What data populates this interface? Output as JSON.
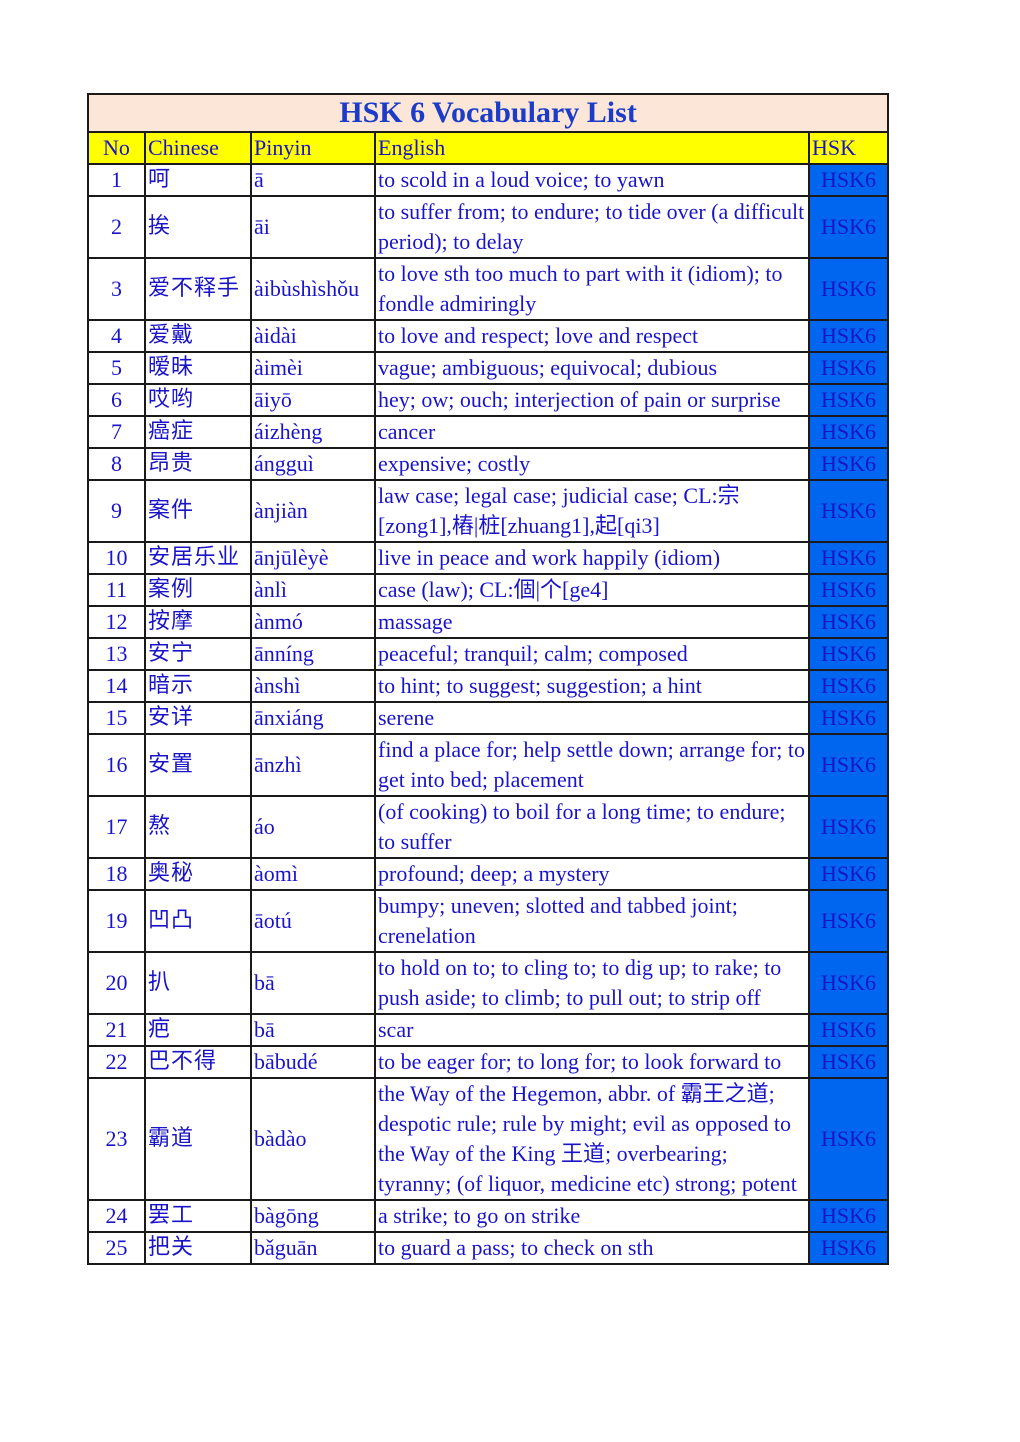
{
  "title": "HSK 6 Vocabulary List",
  "columns": {
    "no": "No",
    "chinese": "Chinese",
    "pinyin": "Pinyin",
    "english": "English",
    "hsk": "HSK"
  },
  "colors": {
    "title_bg": "#fce6d8",
    "header_bg": "#ffff00",
    "hsk_bg": "#0066f0",
    "text": "#1a14c8"
  },
  "rows": [
    {
      "no": "1",
      "chinese": "呵",
      "pinyin": "ā",
      "english": "to scold in a loud voice; to yawn",
      "hsk": "HSK6"
    },
    {
      "no": "2",
      "chinese": "挨",
      "pinyin": "āi",
      "english": "to suffer from; to endure; to tide over (a difficult period); to delay",
      "hsk": "HSK6"
    },
    {
      "no": "3",
      "chinese": "爱不释手",
      "pinyin": "àibùshìshǒu",
      "english": "to love sth too much to part with it (idiom); to fondle admiringly",
      "hsk": "HSK6"
    },
    {
      "no": "4",
      "chinese": "爱戴",
      "pinyin": "àidài",
      "english": "to love and respect; love and respect",
      "hsk": "HSK6"
    },
    {
      "no": "5",
      "chinese": "暧昧",
      "pinyin": "àimèi",
      "english": "vague; ambiguous; equivocal; dubious",
      "hsk": "HSK6"
    },
    {
      "no": "6",
      "chinese": "哎哟",
      "pinyin": "āiyō",
      "english": "hey; ow; ouch; interjection of pain or surprise",
      "hsk": "HSK6"
    },
    {
      "no": "7",
      "chinese": "癌症",
      "pinyin": "áizhèng",
      "english": "cancer",
      "hsk": "HSK6"
    },
    {
      "no": "8",
      "chinese": "昂贵",
      "pinyin": "ángguì",
      "english": "expensive; costly",
      "hsk": "HSK6"
    },
    {
      "no": "9",
      "chinese": "案件",
      "pinyin": "ànjiàn",
      "english": "law case; legal case; judicial case; CL:宗[zong1],樁|桩[zhuang1],起[qi3]",
      "hsk": "HSK6"
    },
    {
      "no": "10",
      "chinese": "安居乐业",
      "pinyin": "ānjūlèyè",
      "english": "live in peace and work happily (idiom)",
      "hsk": "HSK6"
    },
    {
      "no": "11",
      "chinese": "案例",
      "pinyin": "ànlì",
      "english": "case (law); CL:個|个[ge4]",
      "hsk": "HSK6"
    },
    {
      "no": "12",
      "chinese": "按摩",
      "pinyin": "ànmó",
      "english": "massage",
      "hsk": "HSK6"
    },
    {
      "no": "13",
      "chinese": "安宁",
      "pinyin": "ānníng",
      "english": "peaceful; tranquil; calm; composed",
      "hsk": "HSK6"
    },
    {
      "no": "14",
      "chinese": "暗示",
      "pinyin": "ànshì",
      "english": "to hint; to suggest; suggestion; a hint",
      "hsk": "HSK6"
    },
    {
      "no": "15",
      "chinese": "安详",
      "pinyin": "ānxiáng",
      "english": "serene",
      "hsk": "HSK6"
    },
    {
      "no": "16",
      "chinese": "安置",
      "pinyin": "ānzhì",
      "english": "find a place for; help settle down; arrange for; to get into bed; placement",
      "hsk": "HSK6"
    },
    {
      "no": "17",
      "chinese": "熬",
      "pinyin": "áo",
      "english": "(of cooking) to boil for a long time; to endure; to suffer",
      "hsk": "HSK6"
    },
    {
      "no": "18",
      "chinese": "奥秘",
      "pinyin": "àomì",
      "english": "profound; deep; a mystery",
      "hsk": "HSK6"
    },
    {
      "no": "19",
      "chinese": "凹凸",
      "pinyin": "āotú",
      "english": "bumpy; uneven; slotted and tabbed joint; crenelation",
      "hsk": "HSK6"
    },
    {
      "no": "20",
      "chinese": "扒",
      "pinyin": "bā",
      "english": "to hold on to; to cling to; to dig up; to rake; to push aside; to climb; to pull out; to strip off",
      "hsk": "HSK6"
    },
    {
      "no": "21",
      "chinese": "疤",
      "pinyin": "bā",
      "english": "scar",
      "hsk": "HSK6"
    },
    {
      "no": "22",
      "chinese": "巴不得",
      "pinyin": "bābudé",
      "english": "to be eager for; to long for; to look forward to",
      "hsk": "HSK6"
    },
    {
      "no": "23",
      "chinese": "霸道",
      "pinyin": "bàdào",
      "english": "the Way of the Hegemon, abbr. of 霸王之道; despotic rule; rule by might; evil as opposed to the Way of the King 王道; overbearing; tyranny; (of liquor, medicine etc) strong; potent",
      "hsk": "HSK6"
    },
    {
      "no": "24",
      "chinese": "罢工",
      "pinyin": "bàgōng",
      "english": "a strike; to go on strike",
      "hsk": "HSK6"
    },
    {
      "no": "25",
      "chinese": "把关",
      "pinyin": "bǎguān",
      "english": "to guard a pass; to check on sth",
      "hsk": "HSK6"
    }
  ]
}
